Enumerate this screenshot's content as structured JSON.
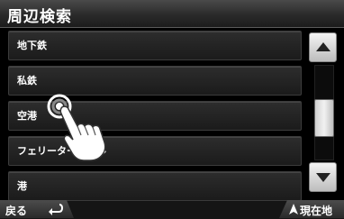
{
  "header": {
    "title": "周辺検索"
  },
  "list": {
    "items": [
      {
        "label": "地下鉄"
      },
      {
        "label": "私鉄"
      },
      {
        "label": "空港"
      },
      {
        "label": "フェリーターミナル"
      },
      {
        "label": "港"
      }
    ]
  },
  "scrollbar": {
    "up_icon": "triangle-up-icon",
    "down_icon": "triangle-down-icon",
    "position": 0.4
  },
  "footer": {
    "back_label": "戻る",
    "back_icon": "return-arrow-icon",
    "current_location_label": "現在地",
    "current_location_icon": "triangle-up-icon"
  },
  "overlay": {
    "icon": "pointing-hand-icon"
  },
  "colors": {
    "background": "#000000",
    "text": "#ffffff",
    "button_light": "#e6e6e6"
  }
}
